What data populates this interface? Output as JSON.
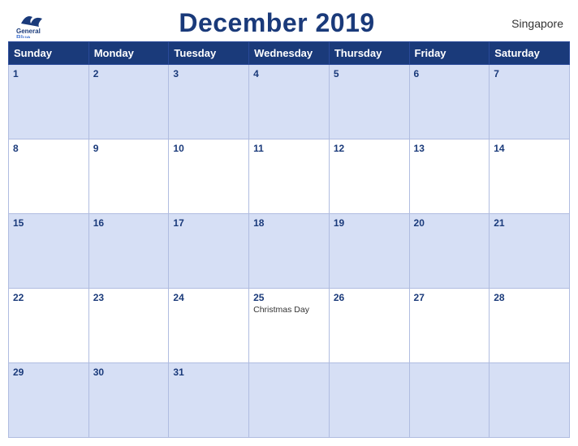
{
  "header": {
    "logo_general": "General",
    "logo_blue": "Blue",
    "title": "December 2019",
    "region": "Singapore"
  },
  "days_of_week": [
    "Sunday",
    "Monday",
    "Tuesday",
    "Wednesday",
    "Thursday",
    "Friday",
    "Saturday"
  ],
  "weeks": [
    [
      {
        "num": "1",
        "event": ""
      },
      {
        "num": "2",
        "event": ""
      },
      {
        "num": "3",
        "event": ""
      },
      {
        "num": "4",
        "event": ""
      },
      {
        "num": "5",
        "event": ""
      },
      {
        "num": "6",
        "event": ""
      },
      {
        "num": "7",
        "event": ""
      }
    ],
    [
      {
        "num": "8",
        "event": ""
      },
      {
        "num": "9",
        "event": ""
      },
      {
        "num": "10",
        "event": ""
      },
      {
        "num": "11",
        "event": ""
      },
      {
        "num": "12",
        "event": ""
      },
      {
        "num": "13",
        "event": ""
      },
      {
        "num": "14",
        "event": ""
      }
    ],
    [
      {
        "num": "15",
        "event": ""
      },
      {
        "num": "16",
        "event": ""
      },
      {
        "num": "17",
        "event": ""
      },
      {
        "num": "18",
        "event": ""
      },
      {
        "num": "19",
        "event": ""
      },
      {
        "num": "20",
        "event": ""
      },
      {
        "num": "21",
        "event": ""
      }
    ],
    [
      {
        "num": "22",
        "event": ""
      },
      {
        "num": "23",
        "event": ""
      },
      {
        "num": "24",
        "event": ""
      },
      {
        "num": "25",
        "event": "Christmas Day"
      },
      {
        "num": "26",
        "event": ""
      },
      {
        "num": "27",
        "event": ""
      },
      {
        "num": "28",
        "event": ""
      }
    ],
    [
      {
        "num": "29",
        "event": ""
      },
      {
        "num": "30",
        "event": ""
      },
      {
        "num": "31",
        "event": ""
      },
      {
        "num": "",
        "event": ""
      },
      {
        "num": "",
        "event": ""
      },
      {
        "num": "",
        "event": ""
      },
      {
        "num": "",
        "event": ""
      }
    ]
  ]
}
